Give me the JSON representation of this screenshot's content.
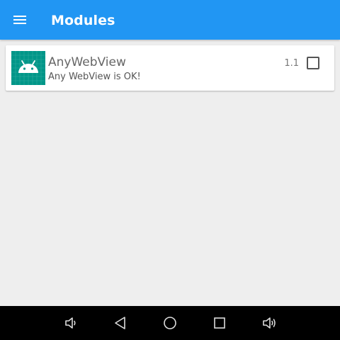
{
  "appbar": {
    "title": "Modules",
    "menu_icon": "hamburger-menu-icon",
    "color": "#2196f3"
  },
  "modules": [
    {
      "name": "AnyWebView",
      "description": "Any WebView is OK!",
      "version": "1.1",
      "enabled": false,
      "icon": "android-icon",
      "icon_color": "#009688"
    }
  ],
  "navbar": {
    "buttons": [
      {
        "icon": "volume-down-icon"
      },
      {
        "icon": "back-icon"
      },
      {
        "icon": "home-icon"
      },
      {
        "icon": "recents-icon"
      },
      {
        "icon": "volume-up-icon"
      }
    ]
  }
}
